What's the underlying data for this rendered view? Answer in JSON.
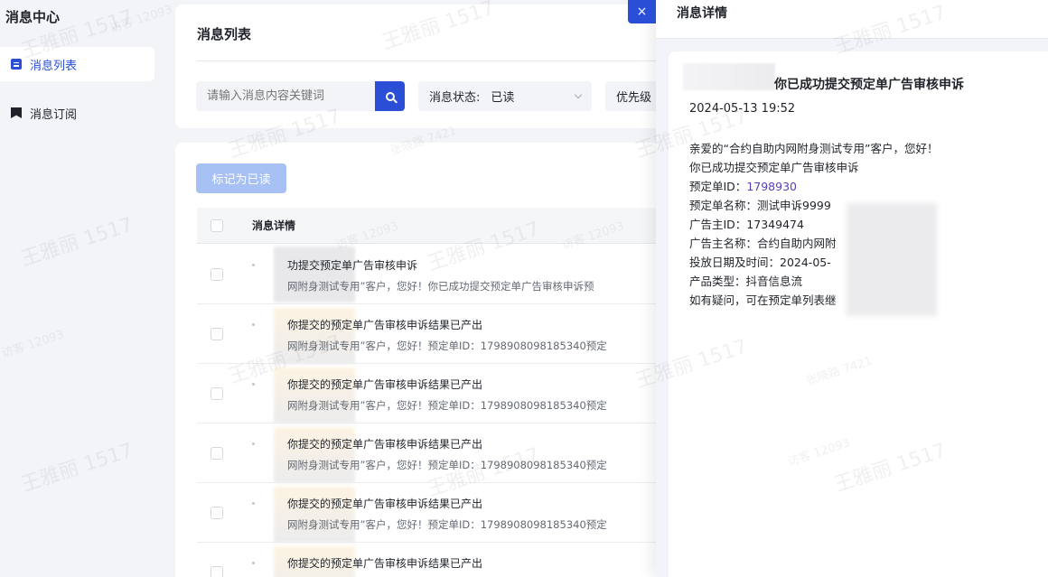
{
  "sidebar": {
    "title": "消息中心",
    "items": [
      {
        "label": "消息列表",
        "icon": "list-icon",
        "active": true
      },
      {
        "label": "消息订阅",
        "icon": "bookmark-icon",
        "active": false
      }
    ]
  },
  "list_panel": {
    "title": "消息列表",
    "search_placeholder": "请输入消息内容关键词",
    "status_label": "消息状态:",
    "status_value": "已读",
    "priority_label": "优先级",
    "mark_read_button": "标记为已读",
    "column_header": "消息详情",
    "rows": [
      {
        "title": "功提交预定单广告审核申诉",
        "desc": "网附身测试专用”客户，您好！你已成功提交预定单广告审核申诉预"
      },
      {
        "title": "你提交的预定单广告审核申诉结果已产出",
        "desc": "网附身测试专用”客户，您好！预定单ID：1798908098185340预定"
      },
      {
        "title": "你提交的预定单广告审核申诉结果已产出",
        "desc": "网附身测试专用”客户，您好！预定单ID：1798908098185340预定"
      },
      {
        "title": "你提交的预定单广告审核申诉结果已产出",
        "desc": "网附身测试专用”客户，您好！预定单ID：1798908098185340预定"
      },
      {
        "title": "你提交的预定单广告审核申诉结果已产出",
        "desc": "网附身测试专用”客户，您好！预定单ID：1798908098185340预定"
      },
      {
        "title": "你提交的预定单广告审核申诉结果已产出",
        "desc": ""
      }
    ]
  },
  "drawer": {
    "close_label": "×",
    "title": "消息详情",
    "message_title": "你已成功提交预定单广告审核申诉",
    "time": "2024-05-13 19:52",
    "greeting": "亲爱的“合约自助内网附身测试专用”客户，您好！",
    "line1": "你已成功提交预定单广告审核申诉",
    "order_id_label": "预定单ID：",
    "order_id_value": "1798930",
    "order_name": "预定单名称：测试申诉9999",
    "advertiser_id": "广告主ID：17349474",
    "advertiser_name": "广告主名称：合约自助内网附",
    "delivery_time": "投放日期及时间：2024-05-",
    "product_type": "产品类型：抖音信息流",
    "footer": "如有疑问，可在预定单列表继"
  },
  "watermark": {
    "name": "王雅丽 1517",
    "visitor": "访客 12093",
    "small": "张晓路 7421"
  },
  "colors": {
    "accent": "#2a4fd6",
    "disabled_button": "#a7c1f4",
    "order_id": "#5a3fb8"
  }
}
